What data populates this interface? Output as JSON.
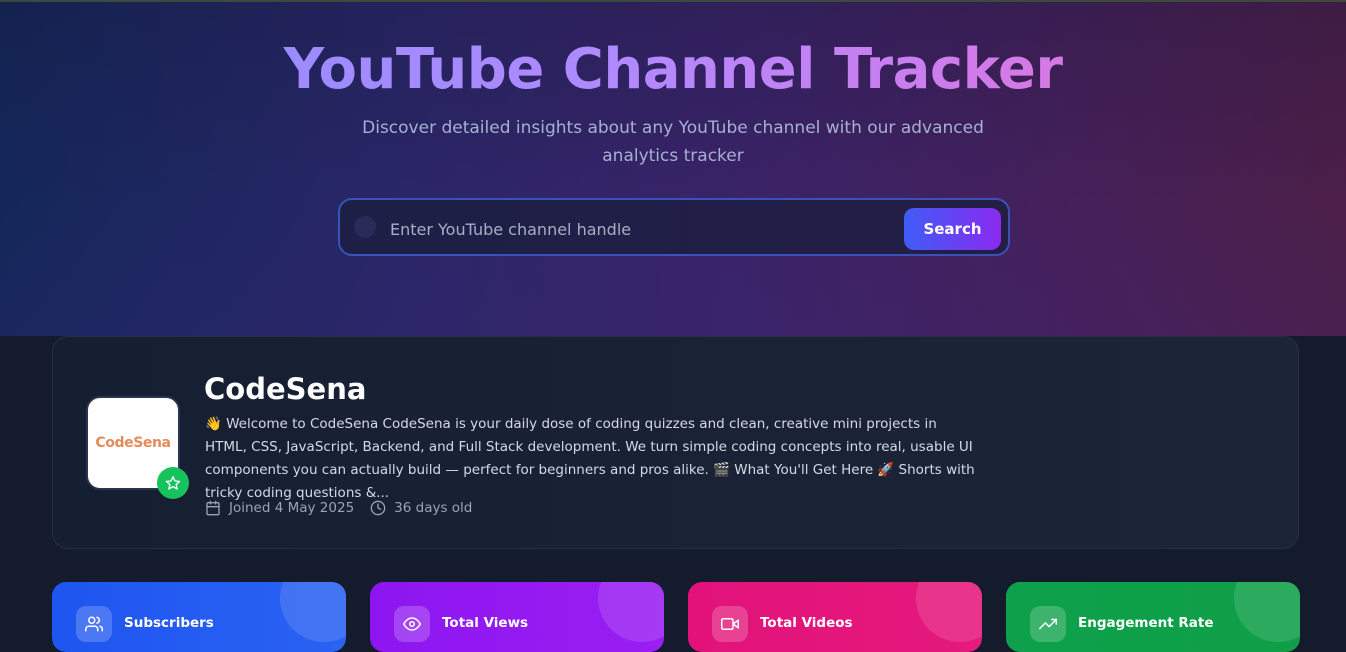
{
  "hero": {
    "title": "YouTube Channel Tracker",
    "subtitle": "Discover detailed insights about any YouTube channel with our advanced analytics tracker"
  },
  "search": {
    "placeholder": "Enter YouTube channel handle",
    "value": "",
    "button_label": "Search"
  },
  "channel": {
    "name": "CodeSena",
    "avatar_text": "CodeSena",
    "description": "👋 Welcome to CodeSena CodeSena is your daily dose of coding quizzes and clean, creative mini projects in HTML, CSS, JavaScript, Backend, and Full Stack development. We turn simple coding concepts into real, usable UI components you can actually build — perfect for beginners and pros alike. 🎬 What You'll Get Here 🚀 Shorts with tricky coding questions &...",
    "joined": "Joined 4 May 2025",
    "age": "36 days old"
  },
  "stats": [
    {
      "label": "Subscribers",
      "icon": "users-icon",
      "color": "#1f55f0"
    },
    {
      "label": "Total Views",
      "icon": "eye-icon",
      "color": "#8d16f0"
    },
    {
      "label": "Total Videos",
      "icon": "video-icon",
      "color": "#e2127a"
    },
    {
      "label": "Engagement Rate",
      "icon": "trending-up-icon",
      "color": "#0ea04a"
    }
  ],
  "colors": {
    "accent_blue": "#3f5cf5",
    "accent_purple": "#8a2bf0",
    "verified_green": "#16c25b"
  }
}
